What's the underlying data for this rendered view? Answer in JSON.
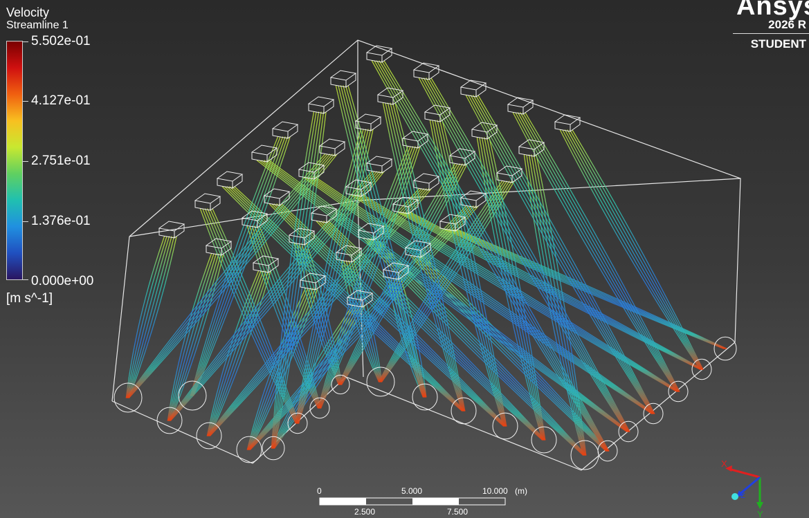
{
  "legend": {
    "variable": "Velocity",
    "object": "Streamline 1",
    "ticks": [
      "5.502e-01",
      "4.127e-01",
      "2.751e-01",
      "1.376e-01",
      "0.000e+00"
    ],
    "units": "[m s^-1]",
    "colormap": [
      "#7a0000",
      "#d01010",
      "#f06010",
      "#f8c020",
      "#c8e830",
      "#60d060",
      "#20c0b0",
      "#2090e0",
      "#2050c0",
      "#2a1560"
    ]
  },
  "branding": {
    "name": "Ansys",
    "version": "2026 R",
    "edition": "STUDENT"
  },
  "scale_bar": {
    "top_labels": [
      "0",
      "5.000",
      "10.000"
    ],
    "bottom_labels": [
      "2.500",
      "7.500"
    ],
    "unit": "(m)"
  },
  "triad": {
    "axes": [
      "X",
      "Y",
      "Z"
    ]
  }
}
